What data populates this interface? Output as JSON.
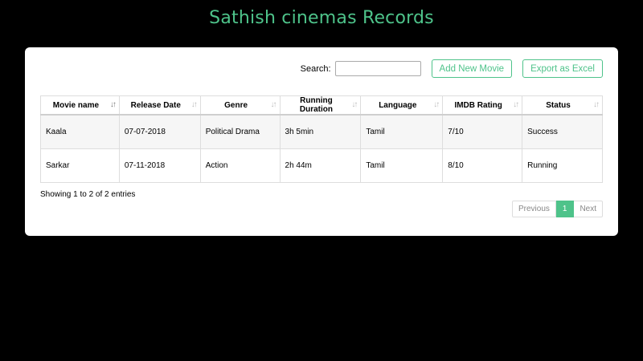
{
  "title": "Sathish cinemas Records",
  "colors": {
    "accent": "#4ec38a",
    "background": "#000000",
    "card": "#ffffff"
  },
  "toolbar": {
    "search_label": "Search:",
    "search_value": "",
    "add_label": "Add New Movie",
    "export_label": "Export as Excel"
  },
  "table": {
    "columns": [
      "Movie name",
      "Release Date",
      "Genre",
      "Running Duration",
      "Language",
      "IMDB Rating",
      "Status"
    ],
    "sorted_column": "Movie name",
    "rows": [
      [
        "Kaala",
        "07-07-2018",
        "Political Drama",
        "3h 5min",
        "Tamil",
        "7/10",
        "Success"
      ],
      [
        "Sarkar",
        "07-11-2018",
        "Action",
        "2h 44m",
        "Tamil",
        "8/10",
        "Running"
      ]
    ]
  },
  "info": "Showing 1 to 2 of 2 entries",
  "pagination": {
    "previous": "Previous",
    "current": "1",
    "next": "Next"
  }
}
